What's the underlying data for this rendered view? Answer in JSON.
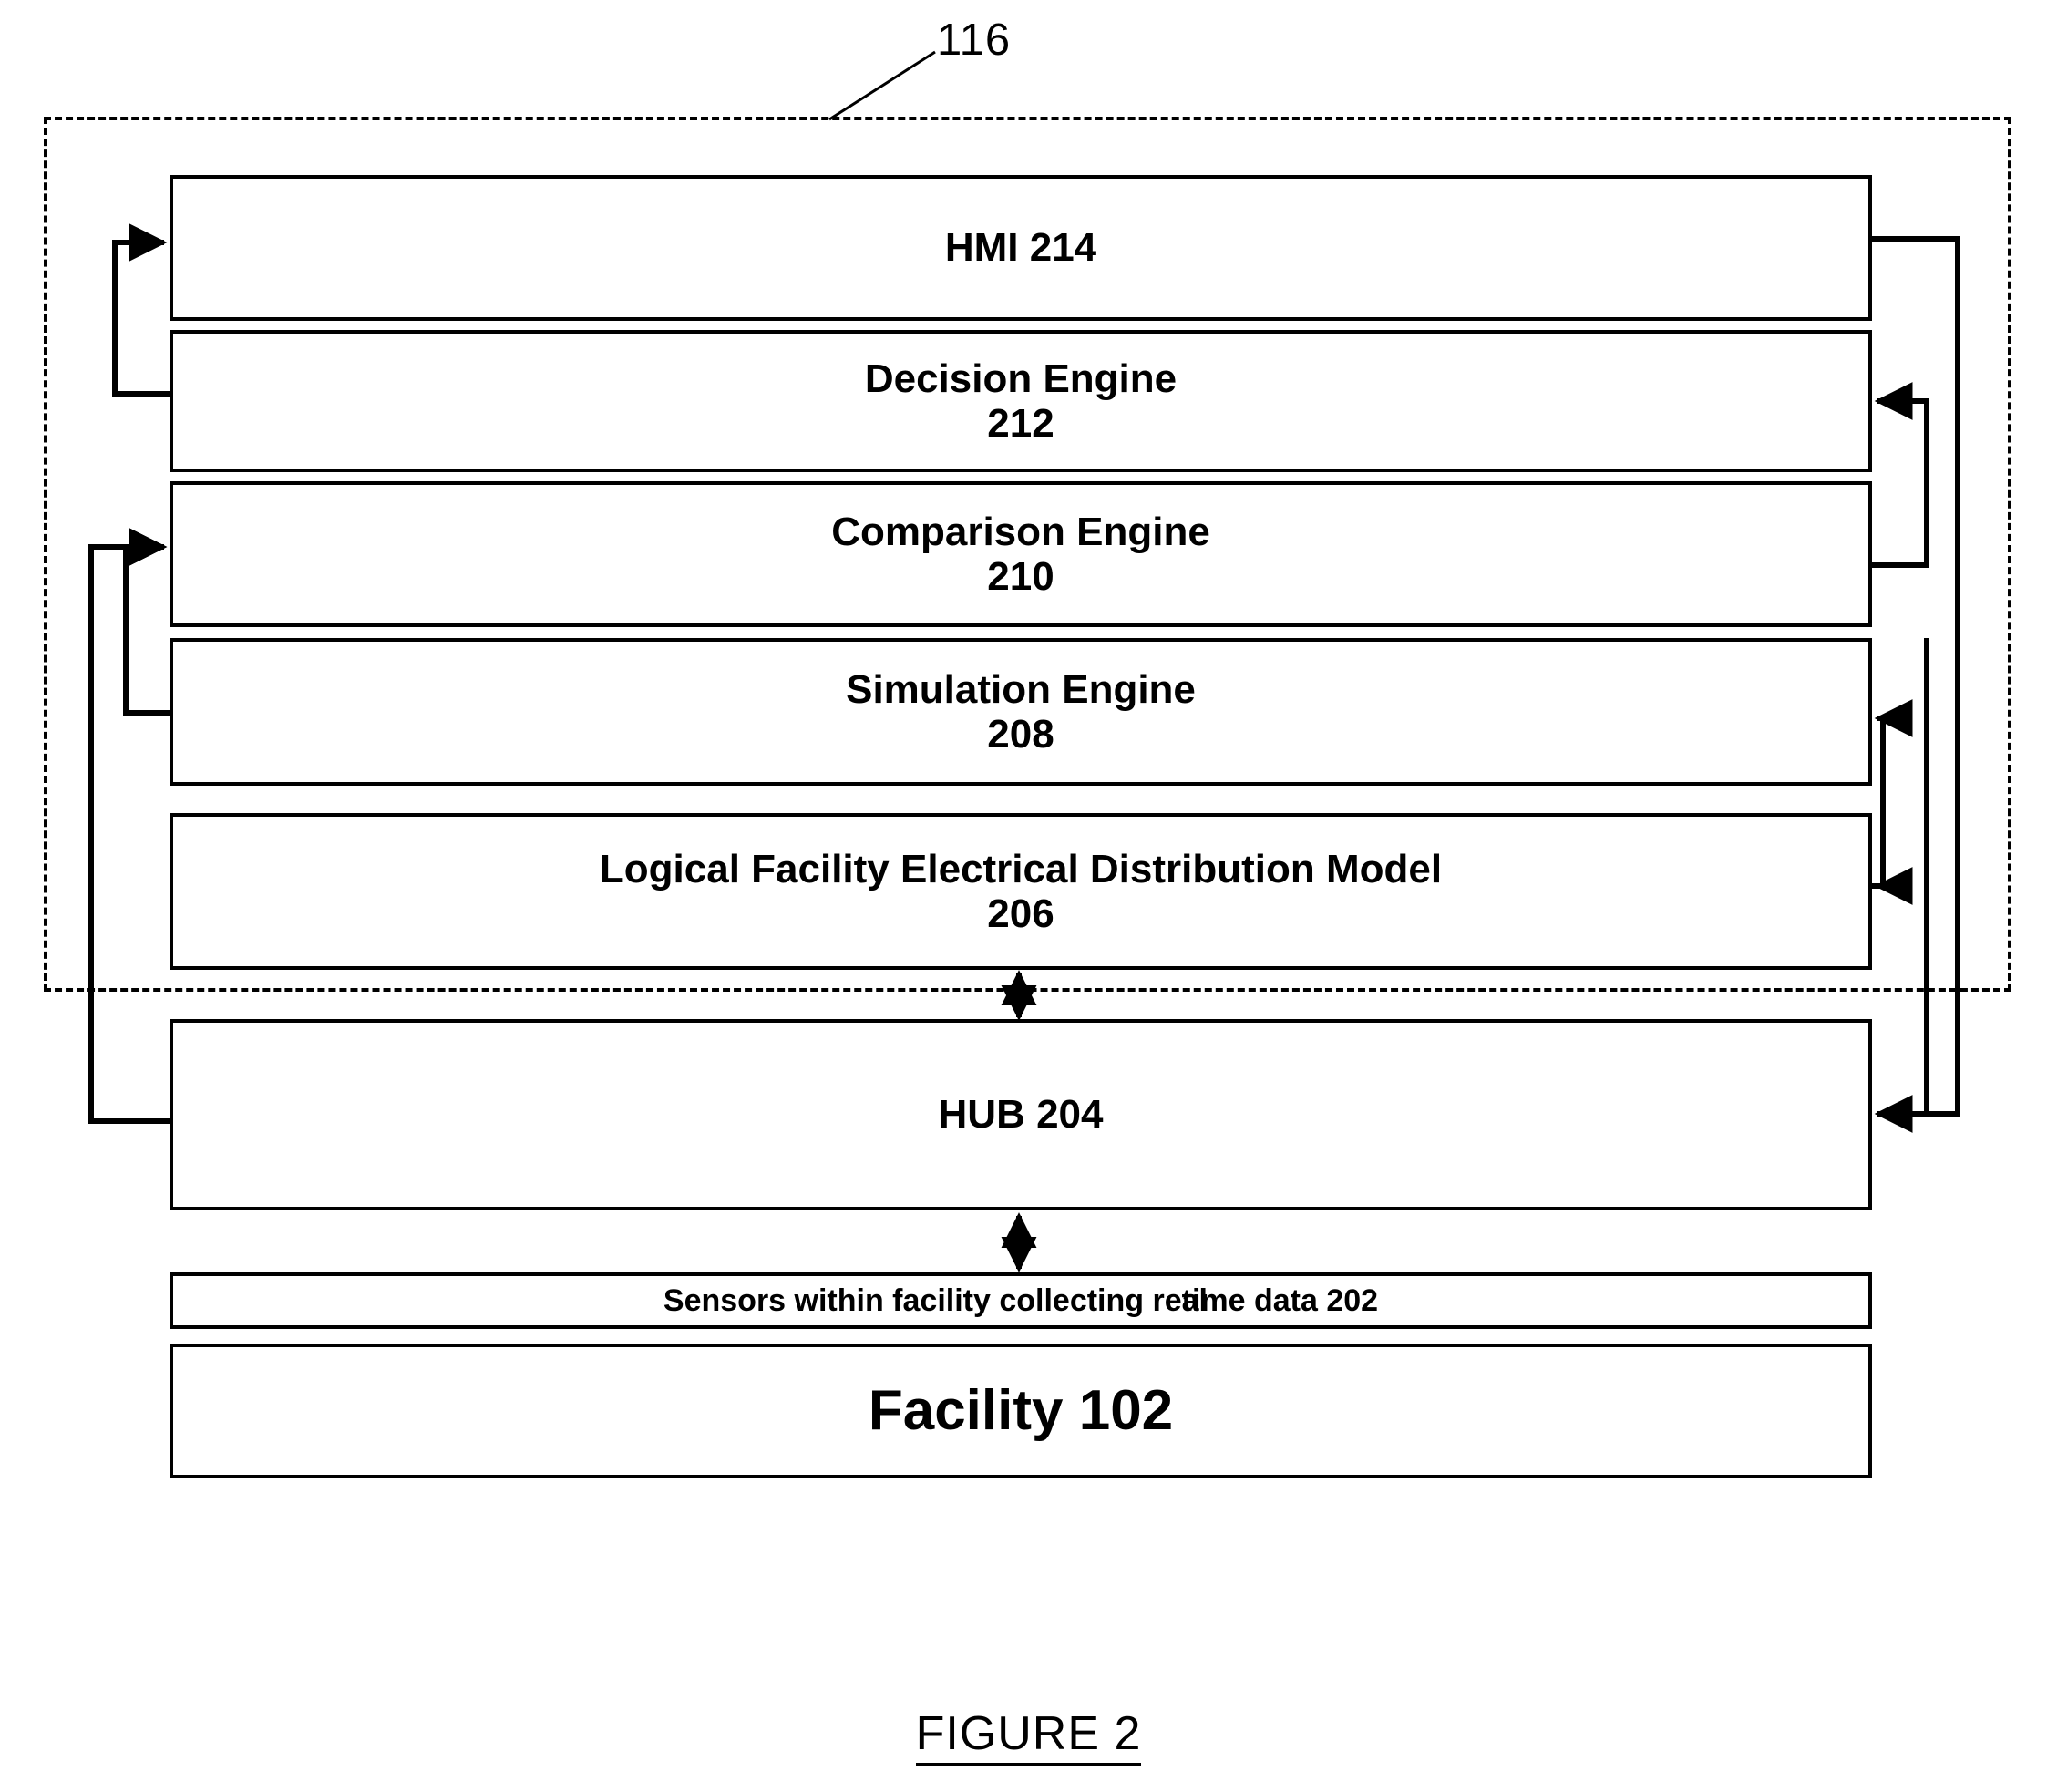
{
  "figure": {
    "caption": "FIGURE 2",
    "system_reference_numeral": "116"
  },
  "boxes": {
    "hmi": {
      "title": "HMI 214"
    },
    "decision_engine": {
      "title": "Decision Engine",
      "numeral": "212"
    },
    "comparison_engine": {
      "title": "Comparison Engine",
      "numeral": "210"
    },
    "simulation_engine": {
      "title": "Simulation Engine",
      "numeral": "208"
    },
    "logical_model": {
      "title": "Logical Facility Electrical Distribution Model",
      "numeral": "206"
    },
    "hub": {
      "title": "HUB 204"
    },
    "sensors": {
      "text_before": "Sensors within facility collecting re",
      "text_overlap": "al",
      "text_after": "time data 202",
      "full_text": "Sensors within facility collecting real time data 202"
    },
    "facility": {
      "title": "Facility 102"
    }
  },
  "colors": {
    "line": "#000000",
    "background": "#ffffff"
  }
}
